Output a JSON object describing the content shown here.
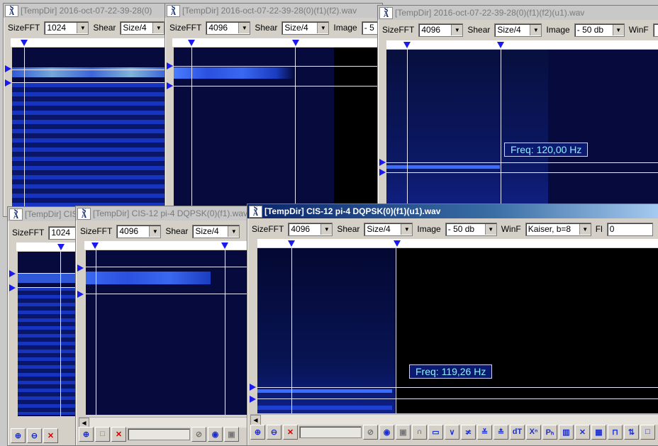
{
  "windows": [
    {
      "id": "w1",
      "title": "[TempDir] 2016-oct-07-22-39-28(0)",
      "sizefft_label": "SizeFFT",
      "sizefft": "1024",
      "shear_label": "Shear",
      "shear": "Size/4"
    },
    {
      "id": "w2",
      "title": "[TempDir] 2016-oct-07-22-39-28(0)(f1)(f2).wav",
      "sizefft_label": "SizeFFT",
      "sizefft": "4096",
      "shear_label": "Shear",
      "shear": "Size/4",
      "image_label": "Image",
      "image": "- 5"
    },
    {
      "id": "w3",
      "title": "[TempDir] 2016-oct-07-22-39-28(0)(f1)(f2)(u1).wav",
      "sizefft_label": "SizeFFT",
      "sizefft": "4096",
      "shear_label": "Shear",
      "shear": "Size/4",
      "image_label": "Image",
      "image": "- 50 db",
      "winf_label": "WinF",
      "freq": "Freq: 120,00 Hz"
    },
    {
      "id": "w4",
      "title": "[TempDir] CIS",
      "sizefft_label": "SizeFFT",
      "sizefft": "1024"
    },
    {
      "id": "w5",
      "title": "[TempDir] CIS-12 pi-4 DQPSK(0)(f1).wav",
      "sizefft_label": "SizeFFT",
      "sizefft": "4096",
      "shear_label": "Shear",
      "shear": "Size/4"
    },
    {
      "id": "w6",
      "title": "[TempDir] CIS-12 pi-4 DQPSK(0)(f1)(u1).wav",
      "sizefft_label": "SizeFFT",
      "sizefft": "4096",
      "shear_label": "Shear",
      "shear": "Size/4",
      "image_label": "Image",
      "image": "- 50 db",
      "winf_label": "WinF",
      "winf": "Kaiser, b=8",
      "fl_label": "Fl",
      "fl": "0",
      "freq": "Freq: 119,26 Hz"
    }
  ],
  "logo": {
    "top": "S",
    "bottom": "Ä"
  },
  "icons": {
    "zoom_in": "⊕",
    "zoom_out": "⊖",
    "close_x": "✕",
    "no": "⊘",
    "speaker": "◉",
    "square": "▣",
    "arc": "∩",
    "rect": "▭",
    "vee": "∨",
    "sym1": "≭",
    "sym2": "≚",
    "sym3": "≛",
    "dt": "dT",
    "xn": "Xⁿ",
    "ph": "Pₕ",
    "bars": "▥",
    "cross": "✕",
    "grid": "▦",
    "pulse": "⊓",
    "updown": "⇅",
    "box": "□"
  },
  "colors": {
    "spectrum_bg": "#060a3c",
    "marker": "#1a1af0",
    "freq_text": "#8ef0ff",
    "active_title": "#0a246a"
  }
}
